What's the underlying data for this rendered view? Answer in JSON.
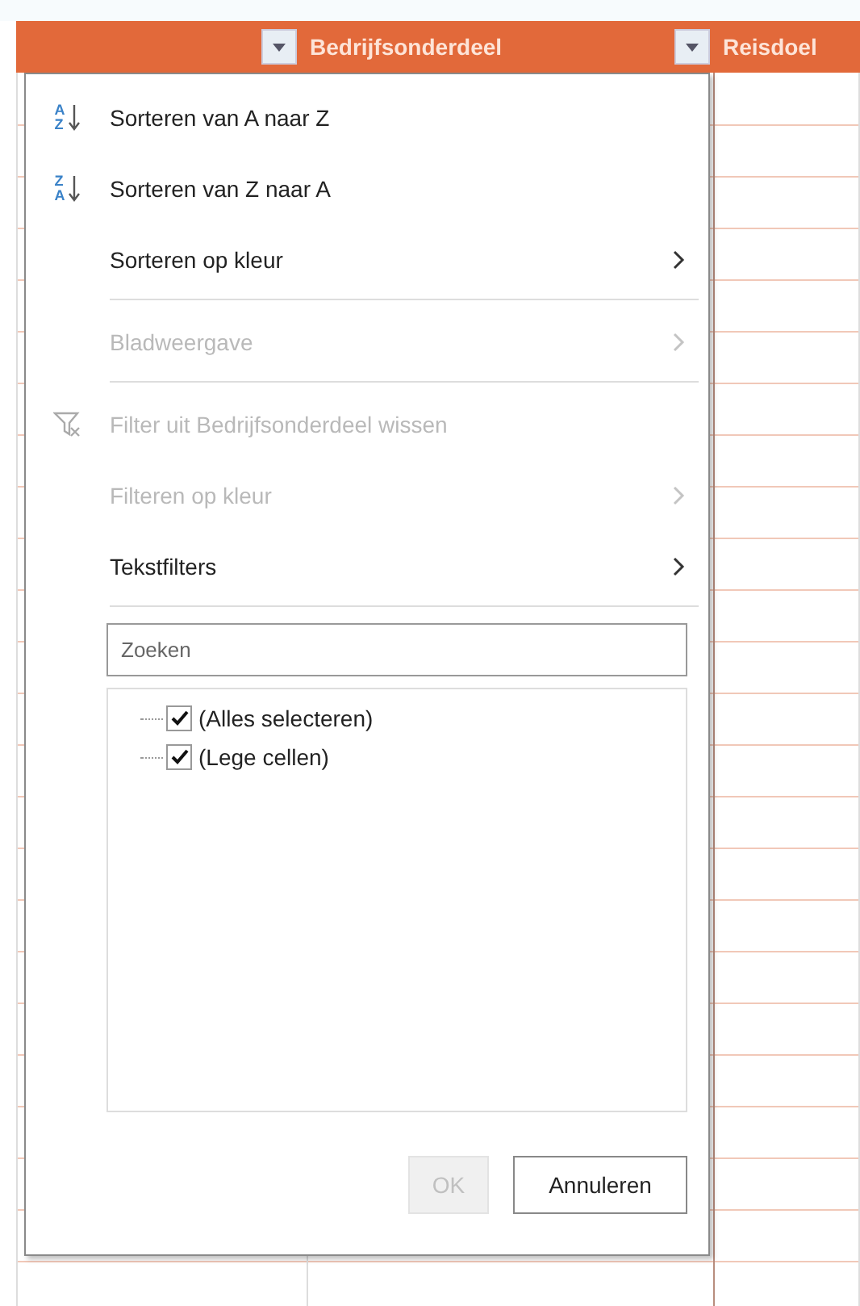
{
  "header": {
    "columns": [
      {
        "label": "Bedrijfsonderdeel",
        "filter_button": true
      },
      {
        "label": "Reisdoel",
        "filter_button": true
      }
    ]
  },
  "filter_menu": {
    "items": [
      {
        "kind": "sort_ascending",
        "label": "Sorteren van A naar Z",
        "icon_top": "A",
        "icon_bottom": "Z",
        "disabled": false,
        "submenu": false,
        "separator_after": false
      },
      {
        "kind": "sort_descending",
        "label": "Sorteren van Z naar A",
        "icon_top": "Z",
        "icon_bottom": "A",
        "disabled": false,
        "submenu": false,
        "separator_after": false
      },
      {
        "kind": "plain",
        "label": "Sorteren op kleur",
        "disabled": false,
        "submenu": true,
        "separator_after": true
      },
      {
        "kind": "plain",
        "label": "Bladweergave",
        "disabled": true,
        "submenu": true,
        "separator_after": true
      },
      {
        "kind": "clear_filter",
        "label": "Filter uit Bedrijfsonderdeel wissen",
        "disabled": true,
        "submenu": false,
        "separator_after": false
      },
      {
        "kind": "plain",
        "label": "Filteren op kleur",
        "disabled": true,
        "submenu": true,
        "separator_after": false
      },
      {
        "kind": "plain",
        "label": "Tekstfilters",
        "disabled": false,
        "submenu": true,
        "separator_after": true
      }
    ],
    "search": {
      "placeholder": "Zoeken"
    },
    "values": [
      {
        "label": "(Alles selecteren)",
        "checked": true
      },
      {
        "label": "(Lege cellen)",
        "checked": true
      }
    ],
    "buttons": [
      {
        "label": "OK",
        "disabled": true
      },
      {
        "label": "Annuleren",
        "disabled": false
      }
    ]
  }
}
